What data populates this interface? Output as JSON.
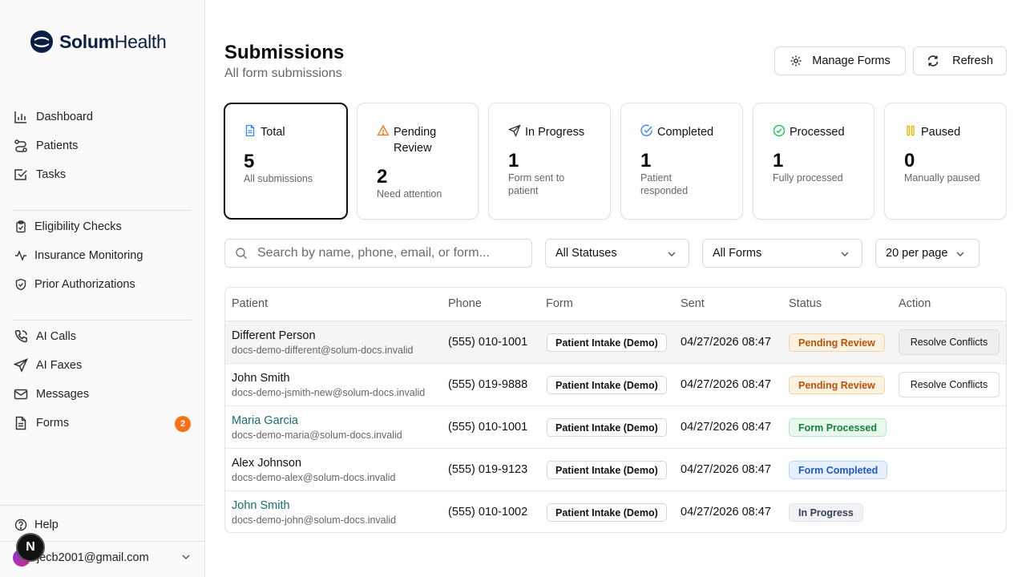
{
  "brand": {
    "name_bold": "Solum",
    "name_light": "Health"
  },
  "sidebar": {
    "items": [
      {
        "label": "Dashboard",
        "icon": "bar-chart-icon"
      },
      {
        "label": "Patients",
        "icon": "route-icon"
      },
      {
        "label": "Tasks",
        "icon": "checkbox-icon"
      },
      {
        "label": "Eligibility Checks",
        "icon": "clipboard-check-icon"
      },
      {
        "label": "Insurance Monitoring",
        "icon": "activity-icon"
      },
      {
        "label": "Prior Authorizations",
        "icon": "shield-check-icon"
      },
      {
        "label": "AI Calls",
        "icon": "phone-icon"
      },
      {
        "label": "AI Faxes",
        "icon": "send-icon"
      },
      {
        "label": "Messages",
        "icon": "mail-icon"
      },
      {
        "label": "Forms",
        "icon": "file-text-icon",
        "badge": "2"
      }
    ],
    "help": "Help",
    "user_email": "jecb2001@gmail.com",
    "dev_badge": "N"
  },
  "header": {
    "title": "Submissions",
    "subtitle": "All form submissions",
    "manage_forms": "Manage Forms",
    "refresh": "Refresh"
  },
  "cards": [
    {
      "title": "Total",
      "value": "5",
      "desc": "All submissions",
      "icon": "file-icon",
      "color": "#3b82f6"
    },
    {
      "title": "Pending Review",
      "value": "2",
      "desc": "Need attention",
      "icon": "warning-icon",
      "color": "#f97316"
    },
    {
      "title": "In Progress",
      "value": "1",
      "desc": "Form sent to patient",
      "icon": "send-icon",
      "color": "#333333"
    },
    {
      "title": "Completed",
      "value": "1",
      "desc": "Patient responded",
      "icon": "check-circle-icon",
      "color": "#3b82f6"
    },
    {
      "title": "Processed",
      "value": "1",
      "desc": "Fully processed",
      "icon": "check-circle-icon",
      "color": "#22c55e"
    },
    {
      "title": "Paused",
      "value": "0",
      "desc": "Manually paused",
      "icon": "pause-icon",
      "color": "#eab308"
    }
  ],
  "filters": {
    "search_placeholder": "Search by name, phone, email, or form...",
    "status": "All Statuses",
    "forms": "All Forms",
    "per_page": "20 per page"
  },
  "table": {
    "headers": [
      "Patient",
      "Phone",
      "Form",
      "Sent",
      "Status",
      "Action"
    ],
    "rows": [
      {
        "name": "Different Person",
        "email": "docs-demo-different@solum-docs.invalid",
        "phone": "(555) 010-1001",
        "form": "Patient Intake (Demo)",
        "sent": "04/27/2026 08:47",
        "status": "Pending Review",
        "status_kind": "pending",
        "action": "Resolve Conflicts",
        "link": false
      },
      {
        "name": "John Smith",
        "email": "docs-demo-jsmith-new@solum-docs.invalid",
        "phone": "(555) 019-9888",
        "form": "Patient Intake (Demo)",
        "sent": "04/27/2026 08:47",
        "status": "Pending Review",
        "status_kind": "pending",
        "action": "Resolve Conflicts",
        "link": false
      },
      {
        "name": "Maria Garcia",
        "email": "docs-demo-maria@solum-docs.invalid",
        "phone": "(555) 010-1001",
        "form": "Patient Intake (Demo)",
        "sent": "04/27/2026 08:47",
        "status": "Form Processed",
        "status_kind": "processed",
        "action": "",
        "link": true
      },
      {
        "name": "Alex Johnson",
        "email": "docs-demo-alex@solum-docs.invalid",
        "phone": "(555) 019-9123",
        "form": "Patient Intake (Demo)",
        "sent": "04/27/2026 08:47",
        "status": "Form Completed",
        "status_kind": "completed",
        "action": "",
        "link": false
      },
      {
        "name": "John Smith",
        "email": "docs-demo-john@solum-docs.invalid",
        "phone": "(555) 010-1002",
        "form": "Patient Intake (Demo)",
        "sent": "04/27/2026 08:47",
        "status": "In Progress",
        "status_kind": "progress",
        "action": "",
        "link": true
      }
    ]
  }
}
